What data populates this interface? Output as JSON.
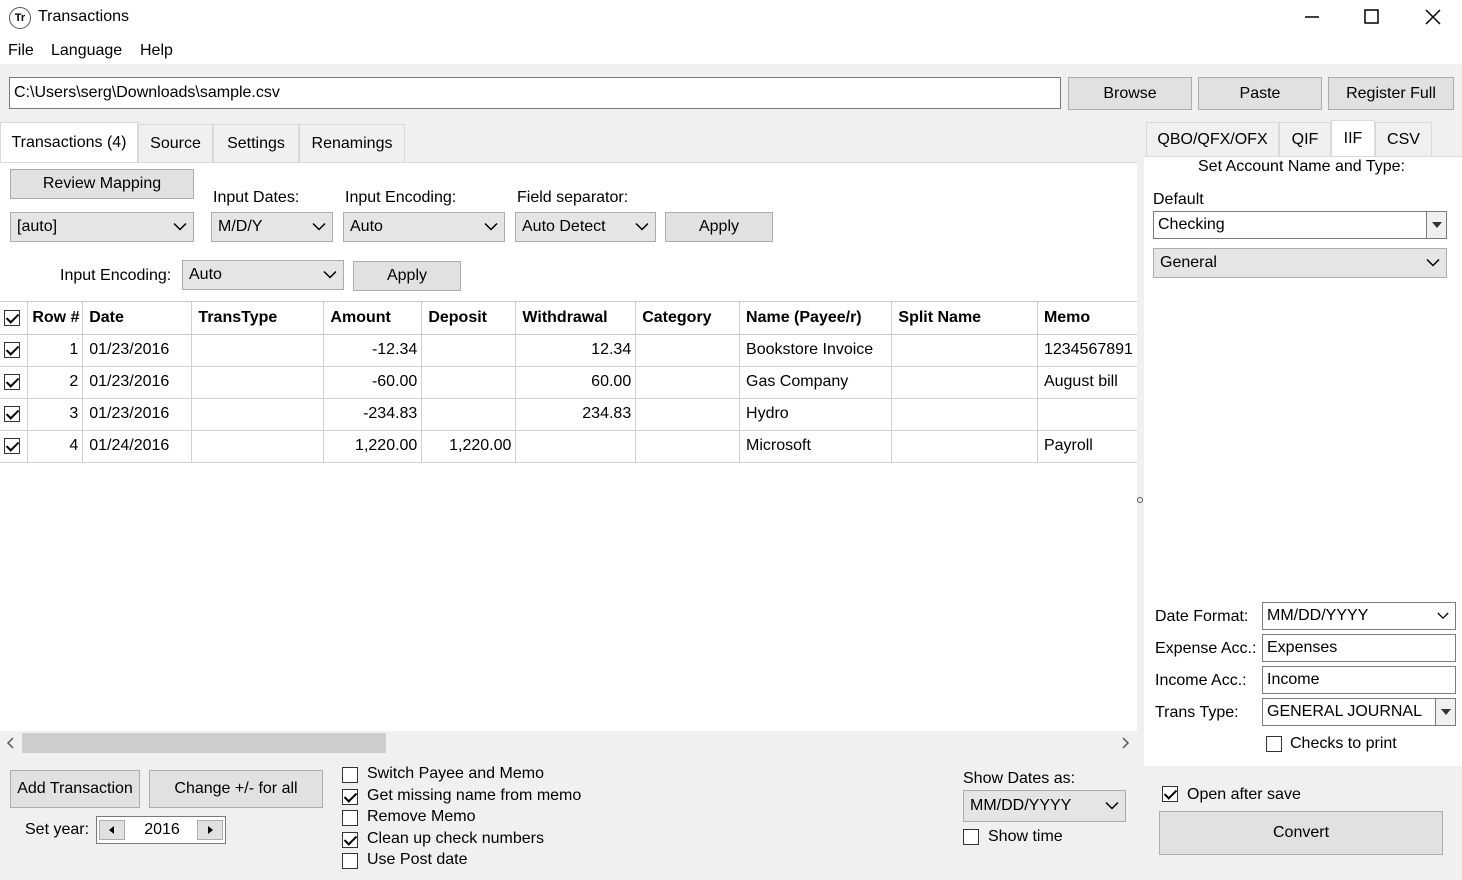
{
  "window": {
    "icon_text": "Tr",
    "title": "Transactions"
  },
  "menu": {
    "file": "File",
    "language": "Language",
    "help": "Help"
  },
  "path_bar": {
    "value": "C:\\Users\\serg\\Downloads\\sample.csv",
    "browse": "Browse",
    "paste": "Paste",
    "register": "Register Full"
  },
  "left_tabs": {
    "transactions": "Transactions (4)",
    "source": "Source",
    "settings": "Settings",
    "renamings": "Renamings"
  },
  "controls": {
    "review_mapping": "Review Mapping",
    "mapping_value": "[auto]",
    "input_dates_label": "Input Dates:",
    "input_dates_value": "M/D/Y",
    "input_encoding_label": "Input Encoding:",
    "input_encoding_value": "Auto",
    "field_separator_label": "Field separator:",
    "field_separator_value": "Auto Detect",
    "apply": "Apply",
    "input_encoding_label2": "Input Encoding:",
    "input_encoding_value2": "Auto",
    "apply2": "Apply"
  },
  "table": {
    "columns": [
      "Row #",
      "Date",
      "TransType",
      "Amount",
      "Deposit",
      "Withdrawal",
      "Category",
      "Name (Payee/r)",
      "Split Name",
      "Memo"
    ],
    "rows": [
      {
        "checked": true,
        "row": "1",
        "date": "01/23/2016",
        "transtype": "",
        "amount": "-12.34",
        "deposit": "",
        "withdrawal": "12.34",
        "category": "",
        "name": "Bookstore Invoice",
        "split": "",
        "memo": "1234567891"
      },
      {
        "checked": true,
        "row": "2",
        "date": "01/23/2016",
        "transtype": "",
        "amount": "-60.00",
        "deposit": "",
        "withdrawal": "60.00",
        "category": "",
        "name": "Gas Company",
        "split": "",
        "memo": "August bill"
      },
      {
        "checked": true,
        "row": "3",
        "date": "01/23/2016",
        "transtype": "",
        "amount": "-234.83",
        "deposit": "",
        "withdrawal": "234.83",
        "category": "",
        "name": "Hydro",
        "split": "",
        "memo": ""
      },
      {
        "checked": true,
        "row": "4",
        "date": "01/24/2016",
        "transtype": "",
        "amount": "1,220.00",
        "deposit": "1,220.00",
        "withdrawal": "",
        "category": "",
        "name": "Microsoft",
        "split": "",
        "memo": "Payroll"
      }
    ]
  },
  "bottom": {
    "add_transaction": "Add Transaction",
    "change_sign": "Change +/- for all",
    "set_year_label": "Set year:",
    "year": "2016",
    "options": [
      {
        "label": "Switch Payee and Memo",
        "checked": false
      },
      {
        "label": "Get missing name from memo",
        "checked": true
      },
      {
        "label": "Remove Memo",
        "checked": false
      },
      {
        "label": "Clean up check numbers",
        "checked": true
      },
      {
        "label": "Use Post date",
        "checked": false
      }
    ],
    "show_dates_label": "Show Dates as:",
    "show_dates_value": "MM/DD/YYYY",
    "show_time": "Show time"
  },
  "right_tabs": {
    "qbo": "QBO/QFX/OFX",
    "qif": "QIF",
    "iif": "IIF",
    "csv": "CSV"
  },
  "right": {
    "set_account": "Set Account Name and Type:",
    "default_label": "Default",
    "account_name": "Checking",
    "account_type": "General",
    "date_format_label": "Date Format:",
    "date_format": "MM/DD/YYYY",
    "expense_label": "Expense Acc.:",
    "expense": "Expenses",
    "income_label": "Income Acc.:",
    "income": "Income",
    "trans_type_label": "Trans Type:",
    "trans_type": "GENERAL JOURNAL",
    "checks_to_print": "Checks to print",
    "open_after_save": "Open after save",
    "convert": "Convert"
  }
}
